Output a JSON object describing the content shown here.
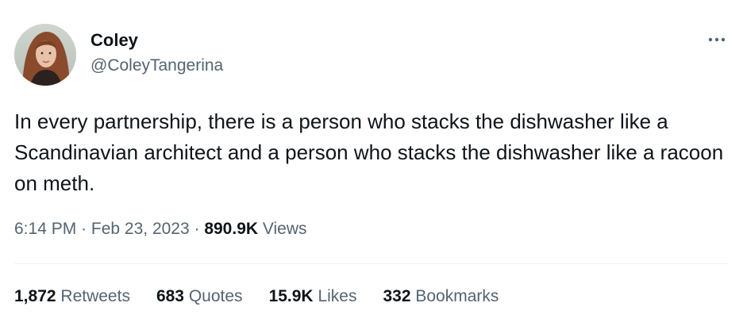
{
  "author": {
    "display_name": "Coley",
    "handle": "@ColeyTangerina"
  },
  "more_icon": "more-horizontal-icon",
  "tweet": {
    "text": "In every partnership, there is a person who stacks the dishwasher like a Scandinavian architect and a person who stacks the dishwasher like a racoon on meth."
  },
  "meta": {
    "time": "6:14 PM",
    "separator": " · ",
    "date": "Feb 23, 2023",
    "views_count": "890.9K",
    "views_label": "Views"
  },
  "stats": {
    "retweets_count": "1,872",
    "retweets_label": "Retweets",
    "quotes_count": "683",
    "quotes_label": "Quotes",
    "likes_count": "15.9K",
    "likes_label": "Likes",
    "bookmarks_count": "332",
    "bookmarks_label": "Bookmarks"
  },
  "colors": {
    "primary_text": "#0f1419",
    "secondary_text": "#536471",
    "divider": "#eff3f4"
  }
}
